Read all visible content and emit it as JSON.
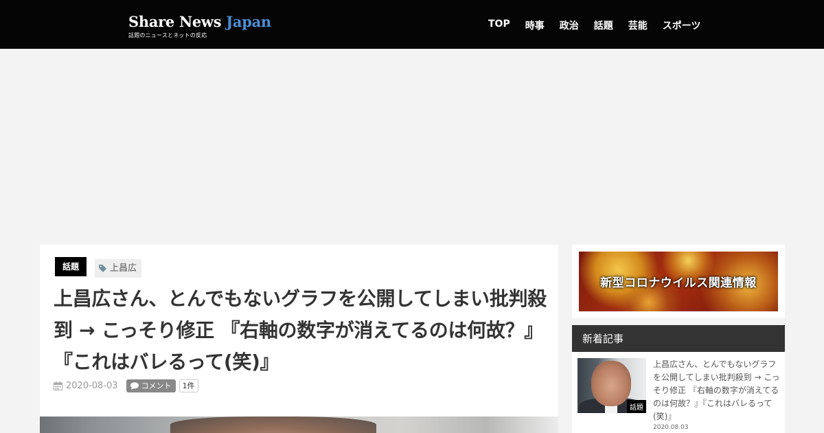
{
  "header": {
    "logo_main": "Share News ",
    "logo_accent": "Japan",
    "logo_sub": "話題のニュースとネットの反応",
    "nav": [
      {
        "label": "TOP"
      },
      {
        "label": "時事"
      },
      {
        "label": "政治"
      },
      {
        "label": "話題"
      },
      {
        "label": "芸能"
      },
      {
        "label": "スポーツ"
      }
    ]
  },
  "article": {
    "category": "話題",
    "tag": "上昌広",
    "title": "上昌広さん、とんでもないグラフを公開してしまい批判殺到 → こっそり修正 『右軸の数字が消えてるのは何故？』『これはバレるって(笑)』",
    "date": "2020-08-03",
    "comment_label": "コメント",
    "comment_count": "1件"
  },
  "sidebar": {
    "banner_text": "新型コロナウイルス関連情報",
    "recent_heading": "新着記事",
    "recent_posts": [
      {
        "title": "上昌広さん、とんでもないグラフを公開してしまい批判殺到 → こっそり修正 『右軸の数字が消えてるのは何故？』『これはバレるって(笑)』",
        "category": "話題",
        "date": "2020.08.03"
      }
    ]
  },
  "icons": {
    "tag": "tag-icon",
    "calendar": "calendar-icon",
    "comment": "comment-bubble-icon"
  },
  "colors": {
    "header_bg": "#050505",
    "logo_accent": "#4a8fd6",
    "badge_bg": "#000000",
    "widget_head_bg": "#333333"
  }
}
